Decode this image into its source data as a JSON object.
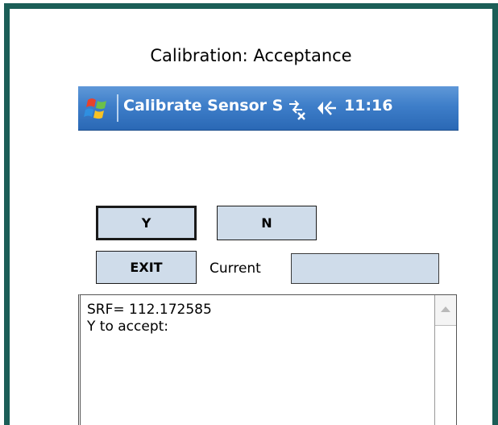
{
  "caption": "Calibration: Acceptance",
  "titlebar": {
    "title": "Calibrate Sensor S",
    "time": "11:16",
    "start_icon": "windows-flag-icon",
    "connectivity_icon": "connectivity-off-icon",
    "volume_icon": "speaker-icon"
  },
  "buttons": {
    "y_label": "Y",
    "n_label": "N",
    "exit_label": "EXIT"
  },
  "current": {
    "label": "Current",
    "value": ""
  },
  "output": {
    "line1": "SRF= 112.172585",
    "line2": "Y to accept:"
  },
  "colors": {
    "frame": "#1b5e57",
    "titlebar": "#3e7ec9",
    "button_fill": "#cfdcea"
  }
}
